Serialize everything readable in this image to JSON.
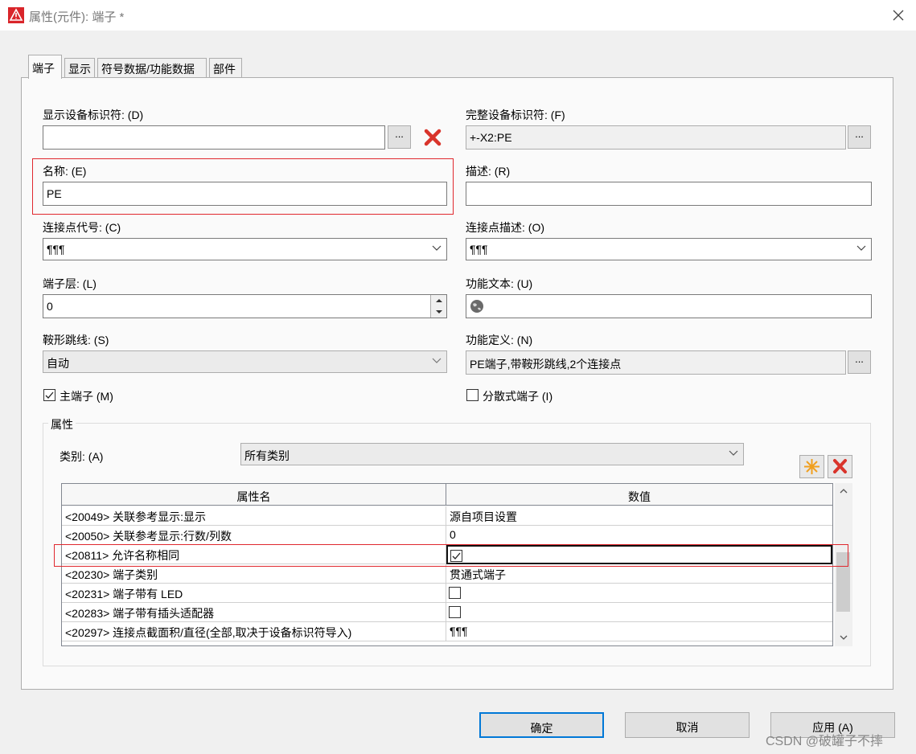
{
  "window": {
    "title": "属性(元件): 端子 *"
  },
  "tabs": [
    {
      "label": "端子"
    },
    {
      "label": "显示"
    },
    {
      "label": "符号数据/功能数据"
    },
    {
      "label": "部件"
    }
  ],
  "left": {
    "dev_id_label": "显示设备标识符: (D)",
    "dev_id_value": "",
    "name_label": "名称: (E)",
    "name_value": "PE",
    "conn_code_label": "连接点代号: (C)",
    "conn_code_value": "¶¶¶",
    "level_label": "端子层: (L)",
    "level_value": "0",
    "jumper_label": "鞍形跳线: (S)",
    "jumper_value": "自动",
    "main_terminal_label": "主端子 (M)",
    "main_terminal_checked": true
  },
  "right": {
    "full_id_label": "完整设备标识符: (F)",
    "full_id_value": "+-X2:PE",
    "desc_label": "描述: (R)",
    "desc_value": "",
    "conn_desc_label": "连接点描述: (O)",
    "conn_desc_value": "¶¶¶",
    "func_text_label": "功能文本: (U)",
    "func_text_value": "",
    "func_def_label": "功能定义: (N)",
    "func_def_value": "PE端子,带鞍形跳线,2个连接点",
    "distributed_label": "分散式端子 (I)",
    "distributed_checked": false
  },
  "dots_label": "...",
  "properties": {
    "group_label": "属性",
    "category_label": "类别: (A)",
    "category_value": "所有类别",
    "columns": {
      "name": "属性名",
      "value": "数值"
    },
    "rows": [
      {
        "name": "<20049> 关联参考显示:显示",
        "value": "源自项目设置",
        "type": "text"
      },
      {
        "name": "<20050> 关联参考显示:行数/列数",
        "value": "0",
        "type": "text"
      },
      {
        "name": "<20811> 允许名称相同",
        "value": "",
        "type": "check",
        "checked": true
      },
      {
        "name": "<20230> 端子类别",
        "value": "贯通式端子",
        "type": "text"
      },
      {
        "name": "<20231> 端子带有 LED",
        "value": "",
        "type": "check",
        "checked": false
      },
      {
        "name": "<20283> 端子带有插头适配器",
        "value": "",
        "type": "check",
        "checked": false
      },
      {
        "name": "<20297> 连接点截面积/直径(全部,取决于设备标识符导入)",
        "value": "¶¶¶",
        "type": "text"
      }
    ]
  },
  "footer": {
    "ok": "确定",
    "cancel": "取消",
    "apply": "应用 (A)"
  },
  "watermark": "CSDN @破罐子不摔",
  "colors": {
    "highlight_red": "#e0282e",
    "delete_red": "#d9342b",
    "new_orange": "#f0a020"
  }
}
